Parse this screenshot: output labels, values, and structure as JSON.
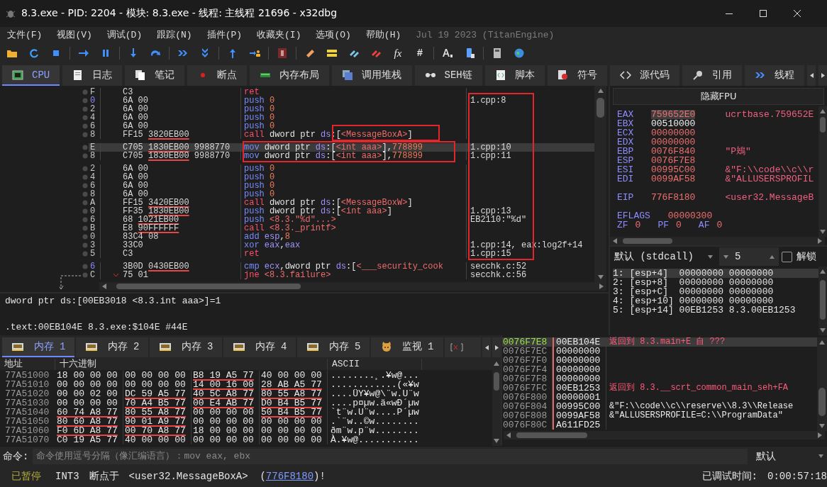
{
  "window": {
    "title": "8.3.exe - PID: 2204 - 模块: 8.3.exe - 线程: 主线程 21696 - x32dbg"
  },
  "menu": [
    "文件(F)",
    "视图(V)",
    "调试(D)",
    "跟踪(N)",
    "插件(P)",
    "收藏夹(I)",
    "选项(O)",
    "帮助(H)"
  ],
  "build": "Jul 19 2023 (TitanEngine)",
  "toolbar": {
    "glyphs": [
      "fx",
      "#"
    ]
  },
  "tabs": [
    {
      "label": "CPU",
      "selected": true
    },
    {
      "label": "日志",
      "selected": false
    },
    {
      "label": "笔记",
      "selected": false
    },
    {
      "label": "断点",
      "selected": false
    },
    {
      "label": "内存布局",
      "selected": false
    },
    {
      "label": "调用堆栈",
      "selected": false
    },
    {
      "label": "SEH链",
      "selected": false
    },
    {
      "label": "脚本",
      "selected": false
    },
    {
      "label": "符号",
      "selected": false
    },
    {
      "label": "源代码",
      "selected": false
    },
    {
      "label": "引用",
      "selected": false
    },
    {
      "label": "线程",
      "selected": false
    }
  ],
  "disassembly": [
    {
      "addr": "F",
      "label": false,
      "selected": false,
      "jump": false,
      "bytes": [
        {
          "text": "C3",
          "underline": false
        }
      ],
      "instr": [
        {
          "kind": "mnj",
          "text": "ret"
        }
      ]
    },
    {
      "addr": "0",
      "label": true,
      "selected": false,
      "jump": false,
      "bytes": [
        {
          "text": "6A",
          "underline": false
        },
        {
          "text": "00",
          "underline": false
        }
      ],
      "instr": [
        {
          "kind": "mn",
          "text": "push "
        },
        {
          "kind": "num",
          "text": "0"
        }
      ],
      "comment": "1.cpp:8"
    },
    {
      "addr": "2",
      "label": false,
      "selected": false,
      "jump": false,
      "bytes": [
        {
          "text": "6A",
          "underline": false
        },
        {
          "text": "00",
          "underline": false
        }
      ],
      "instr": [
        {
          "kind": "mn",
          "text": "push "
        },
        {
          "kind": "num",
          "text": "0"
        }
      ]
    },
    {
      "addr": "4",
      "label": false,
      "selected": false,
      "jump": false,
      "bytes": [
        {
          "text": "6A",
          "underline": false
        },
        {
          "text": "00",
          "underline": false
        }
      ],
      "instr": [
        {
          "kind": "mn",
          "text": "push "
        },
        {
          "kind": "num",
          "text": "0"
        }
      ]
    },
    {
      "addr": "6",
      "label": false,
      "selected": false,
      "jump": false,
      "bytes": [
        {
          "text": "6A",
          "underline": false
        },
        {
          "text": "00",
          "underline": false
        }
      ],
      "instr": [
        {
          "kind": "mn",
          "text": "push "
        },
        {
          "kind": "num",
          "text": "0"
        }
      ]
    },
    {
      "addr": "8",
      "label": false,
      "selected": false,
      "jump": false,
      "bytes": [
        {
          "text": "FF15",
          "underline": false
        },
        {
          "text": "3820EB00",
          "underline": true
        }
      ],
      "instr": [
        {
          "kind": "mnj",
          "text": "call "
        },
        {
          "kind": "txt",
          "text": "dword ptr "
        },
        {
          "kind": "seg",
          "text": "ds"
        },
        {
          "kind": "txt",
          "text": ":["
        },
        {
          "kind": "sym",
          "text": "<MessageBoxA>"
        },
        {
          "kind": "txt",
          "text": "]"
        }
      ]
    },
    {
      "addr": "E",
      "label": false,
      "selected": true,
      "jump": false,
      "bytes": [
        {
          "text": "C705",
          "underline": false
        },
        {
          "text": "1830EB00",
          "underline": true
        },
        {
          "text": "9988770",
          "underline": false
        }
      ],
      "instr": [
        {
          "kind": "mn",
          "text": "mov "
        },
        {
          "kind": "txt",
          "text": "dword ptr "
        },
        {
          "kind": "seg",
          "text": "ds"
        },
        {
          "kind": "txt",
          "text": ":["
        },
        {
          "kind": "sym",
          "text": "<int aaa>"
        },
        {
          "kind": "txt",
          "text": "],"
        },
        {
          "kind": "num",
          "text": "778899"
        }
      ],
      "comment": "1.cpp:10"
    },
    {
      "addr": "8",
      "label": false,
      "selected": false,
      "jump": false,
      "bytes": [
        {
          "text": "C705",
          "underline": false
        },
        {
          "text": "1830EB00",
          "underline": true
        },
        {
          "text": "9988770",
          "underline": false
        }
      ],
      "instr": [
        {
          "kind": "mn",
          "text": "mov "
        },
        {
          "kind": "txt",
          "text": "dword ptr "
        },
        {
          "kind": "seg",
          "text": "ds"
        },
        {
          "kind": "txt",
          "text": ":["
        },
        {
          "kind": "sym",
          "text": "<int aaa>"
        },
        {
          "kind": "txt",
          "text": "],"
        },
        {
          "kind": "num",
          "text": "778899"
        }
      ],
      "comment": "1.cpp:11"
    },
    {
      "addr": "2",
      "label": false,
      "selected": false,
      "jump": false,
      "bytes": [
        {
          "text": "6A",
          "underline": false
        },
        {
          "text": "00",
          "underline": false
        }
      ],
      "instr": [
        {
          "kind": "mn",
          "text": "push "
        },
        {
          "kind": "num",
          "text": "0"
        }
      ]
    },
    {
      "addr": "4",
      "label": false,
      "selected": false,
      "jump": false,
      "bytes": [
        {
          "text": "6A",
          "underline": false
        },
        {
          "text": "00",
          "underline": false
        }
      ],
      "instr": [
        {
          "kind": "mn",
          "text": "push "
        },
        {
          "kind": "num",
          "text": "0"
        }
      ]
    },
    {
      "addr": "6",
      "label": false,
      "selected": false,
      "jump": false,
      "bytes": [
        {
          "text": "6A",
          "underline": false
        },
        {
          "text": "00",
          "underline": false
        }
      ],
      "instr": [
        {
          "kind": "mn",
          "text": "push "
        },
        {
          "kind": "num",
          "text": "0"
        }
      ]
    },
    {
      "addr": "8",
      "label": false,
      "selected": false,
      "jump": false,
      "bytes": [
        {
          "text": "6A",
          "underline": false
        },
        {
          "text": "00",
          "underline": false
        }
      ],
      "instr": [
        {
          "kind": "mn",
          "text": "push "
        },
        {
          "kind": "num",
          "text": "0"
        }
      ]
    },
    {
      "addr": "A",
      "label": false,
      "selected": false,
      "jump": false,
      "bytes": [
        {
          "text": "FF15",
          "underline": false
        },
        {
          "text": "3420EB00",
          "underline": true
        }
      ],
      "instr": [
        {
          "kind": "mnj",
          "text": "call "
        },
        {
          "kind": "txt",
          "text": "dword ptr "
        },
        {
          "kind": "seg",
          "text": "ds"
        },
        {
          "kind": "txt",
          "text": ":["
        },
        {
          "kind": "sym",
          "text": "<MessageBoxW>"
        },
        {
          "kind": "txt",
          "text": "]"
        }
      ]
    },
    {
      "addr": "0",
      "label": false,
      "selected": false,
      "jump": false,
      "bytes": [
        {
          "text": "FF35",
          "underline": false
        },
        {
          "text": "1830EB00",
          "underline": true
        }
      ],
      "instr": [
        {
          "kind": "mn",
          "text": "push "
        },
        {
          "kind": "txt",
          "text": "dword ptr "
        },
        {
          "kind": "seg",
          "text": "ds"
        },
        {
          "kind": "txt",
          "text": ":["
        },
        {
          "kind": "sym",
          "text": "<int aaa>"
        },
        {
          "kind": "txt",
          "text": "]"
        }
      ],
      "comment": "1.cpp:13"
    },
    {
      "addr": "6",
      "label": false,
      "selected": false,
      "jump": false,
      "bytes": [
        {
          "text": "68",
          "underline": false
        },
        {
          "text": "1021EB00",
          "underline": true
        }
      ],
      "instr": [
        {
          "kind": "mn",
          "text": "push "
        },
        {
          "kind": "sym",
          "text": "<8.3.\"%d\"...>"
        }
      ],
      "comment": "EB2110:\"%d\""
    },
    {
      "addr": "B",
      "label": false,
      "selected": false,
      "jump": false,
      "bytes": [
        {
          "text": "E8",
          "underline": false
        },
        {
          "text": "90FFFFFF",
          "underline": true
        }
      ],
      "instr": [
        {
          "kind": "mnj",
          "text": "call "
        },
        {
          "kind": "sym",
          "text": "<8.3._printf>"
        }
      ]
    },
    {
      "addr": "0",
      "label": false,
      "selected": false,
      "jump": false,
      "bytes": [
        {
          "text": "83C4",
          "underline": false
        },
        {
          "text": "08",
          "underline": false
        }
      ],
      "instr": [
        {
          "kind": "mn",
          "text": "add "
        },
        {
          "kind": "reg",
          "text": "esp"
        },
        {
          "kind": "txt",
          "text": ","
        },
        {
          "kind": "num",
          "text": "8"
        }
      ]
    },
    {
      "addr": "3",
      "label": false,
      "selected": false,
      "jump": false,
      "bytes": [
        {
          "text": "33C0",
          "underline": false
        }
      ],
      "instr": [
        {
          "kind": "mn",
          "text": "xor "
        },
        {
          "kind": "reg",
          "text": "eax"
        },
        {
          "kind": "txt",
          "text": ","
        },
        {
          "kind": "reg",
          "text": "eax"
        }
      ],
      "comment": "1.cpp:14, eax:log2f+14"
    },
    {
      "addr": "5",
      "label": false,
      "selected": false,
      "jump": false,
      "bytes": [
        {
          "text": "C3",
          "underline": false
        }
      ],
      "instr": [
        {
          "kind": "mnj",
          "text": "ret"
        }
      ],
      "comment": "1.cpp:15"
    },
    {
      "addr": "6",
      "label": true,
      "selected": false,
      "jump": false,
      "bytes": [
        {
          "text": "3B0D",
          "underline": false
        },
        {
          "text": "0430EB00",
          "underline": true
        }
      ],
      "instr": [
        {
          "kind": "mn",
          "text": "cmp "
        },
        {
          "kind": "reg",
          "text": "ecx"
        },
        {
          "kind": "txt",
          "text": ","
        },
        {
          "kind": "txt",
          "text": "dword ptr "
        },
        {
          "kind": "seg",
          "text": "ds"
        },
        {
          "kind": "txt",
          "text": ":["
        },
        {
          "kind": "sym",
          "text": "<___security_cook"
        }
      ],
      "comment": "secchk.c:52"
    },
    {
      "addr": "C",
      "label": false,
      "selected": false,
      "jump": true,
      "bytes": [
        {
          "text": "75",
          "underline": false
        },
        {
          "text": "01",
          "underline": false
        }
      ],
      "instr": [
        {
          "kind": "mnj",
          "text": "jne "
        },
        {
          "kind": "sym",
          "text": "<8.3.failure>"
        }
      ],
      "comment": "secchk.c:56"
    }
  ],
  "registers": {
    "header": "隐藏FPU",
    "rows": [
      {
        "kind": "reg",
        "name": "EAX",
        "value": "759652E0",
        "changed": true,
        "selected": true,
        "comment": "ucrtbase.759652E"
      },
      {
        "kind": "reg",
        "name": "EBX",
        "value": "00510000",
        "changed": false,
        "selected": false
      },
      {
        "kind": "reg",
        "name": "ECX",
        "value": "00000000",
        "changed": true,
        "selected": false
      },
      {
        "kind": "reg",
        "name": "EDX",
        "value": "00000000",
        "changed": true,
        "selected": false
      },
      {
        "kind": "reg",
        "name": "EBP",
        "value": "0076F840",
        "changed": true,
        "selected": false,
        "comment": "\"P鴂\""
      },
      {
        "kind": "reg",
        "name": "ESP",
        "value": "0076F7E8",
        "changed": true,
        "selected": false
      },
      {
        "kind": "reg",
        "name": "ESI",
        "value": "00995C00",
        "changed": true,
        "selected": false,
        "comment": "&\"F:\\\\code\\\\c\\\\r"
      },
      {
        "kind": "reg",
        "name": "EDI",
        "value": "0099AF58",
        "changed": true,
        "selected": false,
        "comment": "&\"ALLUSERSPROFIL"
      },
      {
        "kind": "gap"
      },
      {
        "kind": "reg",
        "name": "EIP",
        "value": "776F8180",
        "changed": true,
        "selected": false,
        "comment": "<user32.MessageB"
      },
      {
        "kind": "gap"
      },
      {
        "kind": "eflags",
        "name": "EFLAGS",
        "value": "00000300",
        "changed": true,
        "selected": false
      },
      {
        "kind": "flags",
        "flags": [
          {
            "name": "ZF",
            "value": "0"
          },
          {
            "name": "PF",
            "value": "0"
          },
          {
            "name": "AF",
            "value": "0"
          }
        ]
      }
    ]
  },
  "call_args": {
    "convention": "默认 (stdcall)",
    "count": "5",
    "unlock": {
      "label": "解锁",
      "checked": false
    },
    "rows": [
      {
        "text": "1: [esp+4]  00000000 00000000",
        "selected": true
      },
      {
        "text": "2: [esp+8]  00000000 00000000",
        "selected": false
      },
      {
        "text": "3: [esp+C]  00000000 00000000",
        "selected": false
      },
      {
        "text": "4: [esp+10] 00000000 00000000",
        "selected": false
      },
      {
        "text": "5: [esp+14] 00EB1253 8.3.00EB1253",
        "selected": false
      }
    ]
  },
  "info": [
    "dword ptr ds:[00EB3018 <8.3.int aaa>]=1",
    ".text:00EB104E 8.3.exe:$104E #44E"
  ],
  "lower_tabs": [
    {
      "label": "内存 1",
      "selected": true
    },
    {
      "label": "内存 2",
      "selected": false
    },
    {
      "label": "内存 3",
      "selected": false
    },
    {
      "label": "内存 4",
      "selected": false
    },
    {
      "label": "内存 5",
      "selected": false
    },
    {
      "label": "监视 1",
      "selected": false
    }
  ],
  "hex": {
    "columns": [
      "地址",
      "十六进制",
      "ASCII"
    ],
    "rows": [
      {
        "address": "77A51000",
        "groups": [
          {
            "text": "18 00 00 00",
            "underline": false
          },
          {
            "text": "00 00 00 00",
            "underline": false
          },
          {
            "text": "B8 19 A5 77",
            "underline": true
          },
          {
            "text": "40 00 00 00",
            "underline": false
          }
        ],
        "ascii": "........¸.¥w@..."
      },
      {
        "address": "77A51010",
        "groups": [
          {
            "text": "00 00 00 00",
            "underline": false
          },
          {
            "text": "00 00 00 00",
            "underline": false
          },
          {
            "text": "14 00 16 00",
            "underline": true
          },
          {
            "text": "28 AB A5 77",
            "underline": true
          }
        ],
        "ascii": "............(«¥w"
      },
      {
        "address": "77A51020",
        "groups": [
          {
            "text": "00 00 02 00",
            "underline": false
          },
          {
            "text": "DC 59 A5 77",
            "underline": true
          },
          {
            "text": "40 5C A8 77",
            "underline": true
          },
          {
            "text": "80 55 A8 77",
            "underline": true
          }
        ],
        "ascii": "....ÜY¥w@\\¨w.U¨w"
      },
      {
        "address": "77A51030",
        "groups": [
          {
            "text": "00 00 00 00",
            "underline": false
          },
          {
            "text": "70 A4 B5 77",
            "underline": true
          },
          {
            "text": "00 E4 AB 77",
            "underline": true
          },
          {
            "text": "D0 B4 B5 77",
            "underline": true
          }
        ],
        "ascii": "....p¤µw.ä«wÐ´µw"
      },
      {
        "address": "77A51040",
        "groups": [
          {
            "text": "60 74 A8 77",
            "underline": true
          },
          {
            "text": "80 55 A8 77",
            "underline": true
          },
          {
            "text": "00 00 00 00",
            "underline": false
          },
          {
            "text": "50 B4 B5 77",
            "underline": true
          }
        ],
        "ascii": "`t¨w.U¨w....P´µw"
      },
      {
        "address": "77A51050",
        "groups": [
          {
            "text": "80 60 A8 77",
            "underline": true
          },
          {
            "text": "90 01 A9 77",
            "underline": true
          },
          {
            "text": "00 00 00 00",
            "underline": false
          },
          {
            "text": "00 00 00 00",
            "underline": false
          }
        ],
        "ascii": ".`¨w..©w........"
      },
      {
        "address": "77A51060",
        "groups": [
          {
            "text": "F0 6D A8 77",
            "underline": true
          },
          {
            "text": "00 70 A8 77",
            "underline": true
          },
          {
            "text": "18 00 00 00",
            "underline": false
          },
          {
            "text": "00 00 00 00",
            "underline": false
          }
        ],
        "ascii": "ðm¨w.p¨w........"
      },
      {
        "address": "77A51070",
        "groups": [
          {
            "text": "C0 19 A5 77",
            "underline": false
          },
          {
            "text": "40 00 00 00",
            "underline": false
          },
          {
            "text": "00 00 00 00",
            "underline": false
          },
          {
            "text": "00 00 00 00",
            "underline": false
          }
        ],
        "ascii": "À.¥w@..........."
      }
    ]
  },
  "stack": [
    {
      "address": "0076F7E8",
      "value": "00EB104E",
      "comment": "返回到 8.3.main+E 自 ???",
      "kind": "return",
      "selected": true
    },
    {
      "address": "0076F7EC",
      "value": "00000000",
      "selected": false
    },
    {
      "address": "0076F7F0",
      "value": "00000000",
      "selected": false
    },
    {
      "address": "0076F7F4",
      "value": "00000000",
      "selected": false
    },
    {
      "address": "0076F7F8",
      "value": "00000000",
      "selected": false
    },
    {
      "address": "0076F7FC",
      "value": "00EB1253",
      "comment": "返回到 8.3.__scrt_common_main_seh+FA",
      "kind": "return",
      "selected": false
    },
    {
      "address": "0076F800",
      "value": "00000001",
      "selected": false
    },
    {
      "address": "0076F804",
      "value": "00995C00",
      "comment": "&\"F:\\\\code\\\\c\\\\reserve\\\\8.3\\\\Release",
      "kind": "pointer",
      "selected": false
    },
    {
      "address": "0076F808",
      "value": "0099AF58",
      "comment": "&\"ALLUSERSPROFILE=C:\\\\ProgramData\"",
      "kind": "pointer",
      "selected": false
    },
    {
      "address": "0076F80C",
      "value": "A611FD25",
      "selected": false
    }
  ],
  "command": {
    "label": "命令:",
    "placeholder": "命令使用逗号分隔（像汇编语言）：mov eax, ebx",
    "mode": "默认"
  },
  "status": {
    "state": "已暂停",
    "reason": "INT3",
    "location_label": "断点于",
    "message_before": "<user32.MessageBoxA>  (",
    "link": "776F8180",
    "message_after": ")!",
    "time_label": "已调试时间:",
    "time": "0:00:57:18"
  }
}
